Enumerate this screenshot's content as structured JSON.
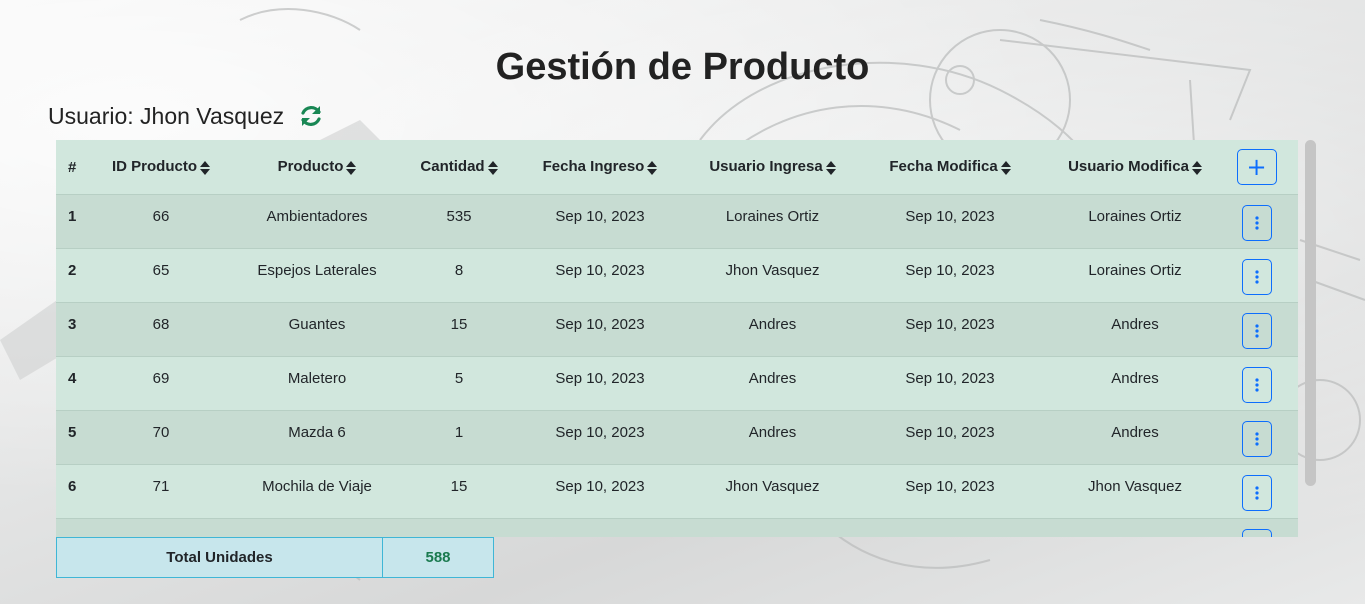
{
  "page": {
    "title": "Gestión de Producto",
    "user_prefix": "Usuario: ",
    "user_name": "Jhon Vasquez"
  },
  "colors": {
    "accent": "#0d6efd",
    "refresh": "#198754",
    "table_bg": "#d1e7dd",
    "total_bg": "#c7e6ec",
    "total_value": "#1a7a4f"
  },
  "icons": {
    "refresh": "refresh-icon",
    "sort": "sort-icon",
    "add": "plus-icon",
    "row_actions": "vertical-ellipsis-icon"
  },
  "table": {
    "columns": [
      "#",
      "ID Producto",
      "Producto",
      "Cantidad",
      "Fecha Ingreso",
      "Usuario Ingresa",
      "Fecha Modifica",
      "Usuario Modifica"
    ],
    "add_label": "+",
    "rows": [
      {
        "n": "1",
        "id": "66",
        "producto": "Ambientadores",
        "cantidad": "535",
        "fecha_ingreso": "Sep 10, 2023",
        "usuario_ingresa": "Loraines Ortiz",
        "fecha_modifica": "Sep 10, 2023",
        "usuario_modifica": "Loraines Ortiz"
      },
      {
        "n": "2",
        "id": "65",
        "producto": "Espejos Laterales",
        "cantidad": "8",
        "fecha_ingreso": "Sep 10, 2023",
        "usuario_ingresa": "Jhon Vasquez",
        "fecha_modifica": "Sep 10, 2023",
        "usuario_modifica": "Loraines Ortiz"
      },
      {
        "n": "3",
        "id": "68",
        "producto": "Guantes",
        "cantidad": "15",
        "fecha_ingreso": "Sep 10, 2023",
        "usuario_ingresa": "Andres",
        "fecha_modifica": "Sep 10, 2023",
        "usuario_modifica": "Andres"
      },
      {
        "n": "4",
        "id": "69",
        "producto": "Maletero",
        "cantidad": "5",
        "fecha_ingreso": "Sep 10, 2023",
        "usuario_ingresa": "Andres",
        "fecha_modifica": "Sep 10, 2023",
        "usuario_modifica": "Andres"
      },
      {
        "n": "5",
        "id": "70",
        "producto": "Mazda 6",
        "cantidad": "1",
        "fecha_ingreso": "Sep 10, 2023",
        "usuario_ingresa": "Andres",
        "fecha_modifica": "Sep 10, 2023",
        "usuario_modifica": "Andres"
      },
      {
        "n": "6",
        "id": "71",
        "producto": "Mochila de Viaje",
        "cantidad": "15",
        "fecha_ingreso": "Sep 10, 2023",
        "usuario_ingresa": "Jhon Vasquez",
        "fecha_modifica": "Sep 10, 2023",
        "usuario_modifica": "Jhon Vasquez"
      },
      {
        "n": "",
        "id": "",
        "producto": "",
        "cantidad": "",
        "fecha_ingreso": "",
        "usuario_ingresa": "",
        "fecha_modifica": "",
        "usuario_modifica": ""
      }
    ]
  },
  "total": {
    "label": "Total Unidades",
    "value": "588"
  }
}
